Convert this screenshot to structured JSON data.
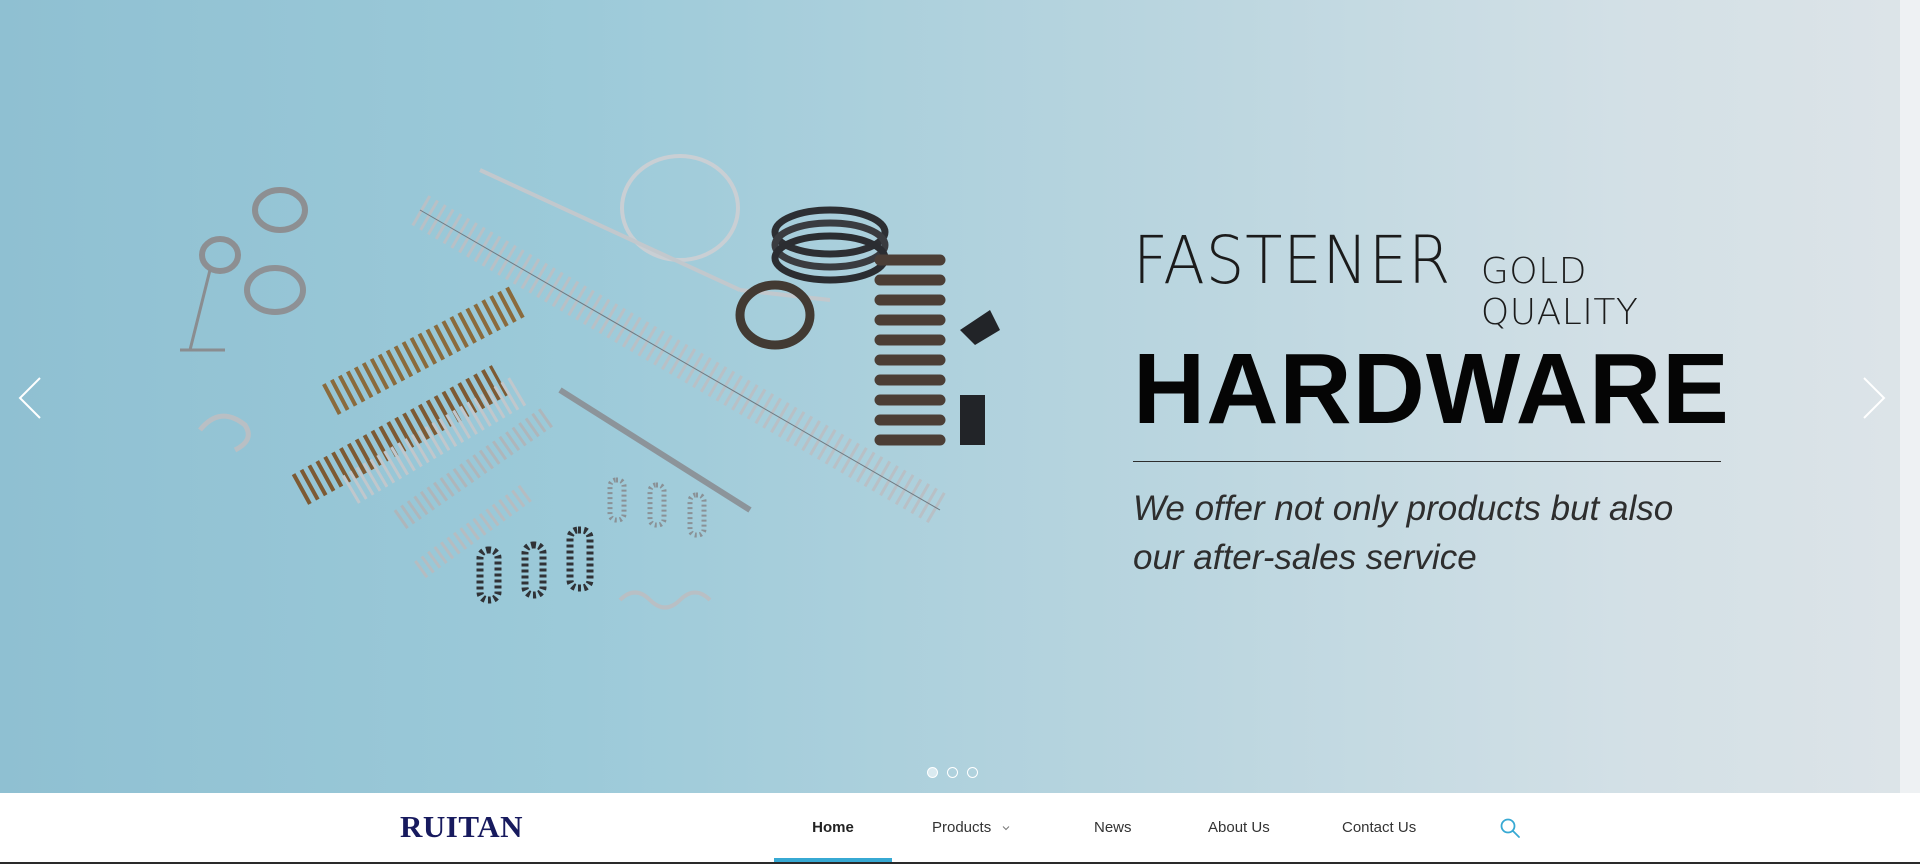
{
  "hero": {
    "line1_main": "FASTENER",
    "line1_sub": "GOLD QUALITY",
    "headline": "HARDWARE",
    "tagline": "We offer not only products but also our after-sales service",
    "slides": [
      {
        "index": 1,
        "active": true
      },
      {
        "index": 2,
        "active": false
      },
      {
        "index": 3,
        "active": false
      }
    ],
    "prev_icon": "chevron-left-icon",
    "next_icon": "chevron-right-icon",
    "image_subject": "springs-collection-image"
  },
  "nav": {
    "logo": "RUITAN",
    "items": [
      {
        "label": "Home",
        "active": true
      },
      {
        "label": "Products",
        "has_dropdown": true
      },
      {
        "label": "News"
      },
      {
        "label": "About Us"
      },
      {
        "label": "Contact Us"
      }
    ],
    "search_icon": "search-icon"
  },
  "colors": {
    "accent": "#37a9d3",
    "logo": "#171a5e",
    "hero_left": "#8fc0d2",
    "hero_right": "#dde4e8"
  }
}
